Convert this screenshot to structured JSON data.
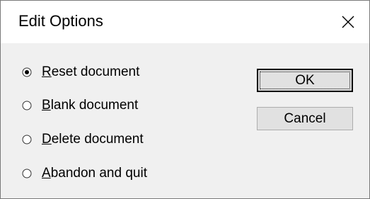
{
  "window": {
    "title": "Edit Options",
    "close_icon": "close-icon"
  },
  "options": [
    {
      "mnemonic": "R",
      "rest": "eset document",
      "checked": true
    },
    {
      "mnemonic": "B",
      "rest": "lank document",
      "checked": false
    },
    {
      "mnemonic": "D",
      "rest": "elete document",
      "checked": false
    },
    {
      "mnemonic": "A",
      "rest": "bandon and quit",
      "checked": false
    }
  ],
  "buttons": {
    "ok_label": "OK",
    "cancel_label": "Cancel"
  }
}
